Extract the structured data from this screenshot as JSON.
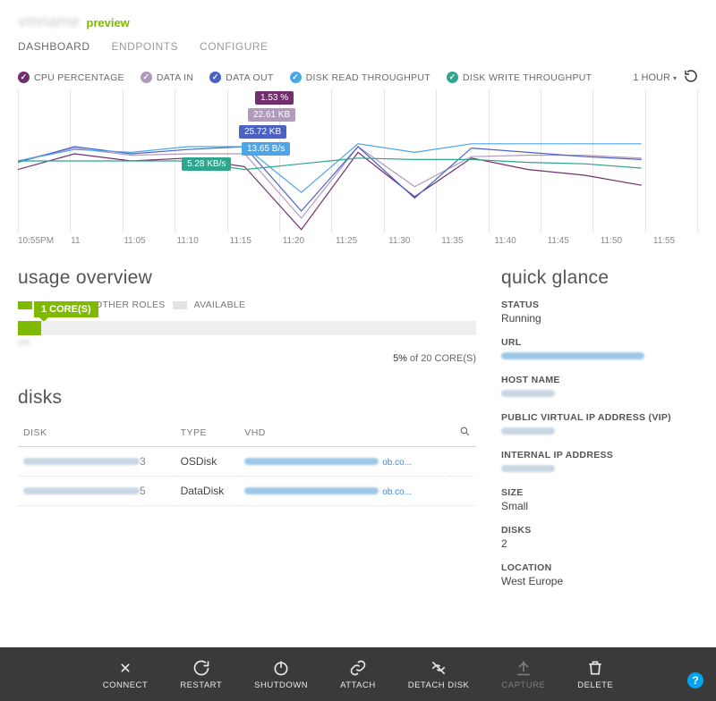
{
  "header": {
    "vm_name": "vmname",
    "preview_label": "preview"
  },
  "tabs": {
    "dashboard": "DASHBOARD",
    "endpoints": "ENDPOINTS",
    "configure": "CONFIGURE",
    "active": "dashboard"
  },
  "chart_legend": {
    "cpu": {
      "label": "CPU PERCENTAGE",
      "color": "#722f6e"
    },
    "data_in": {
      "label": "DATA IN",
      "color": "#b29abf"
    },
    "data_out": {
      "label": "DATA OUT",
      "color": "#4b61c3"
    },
    "disk_read": {
      "label": "DISK READ THROUGHPUT",
      "color": "#4ba6e8"
    },
    "disk_write": {
      "label": "DISK WRITE THROUGHPUT",
      "color": "#2fa58e"
    }
  },
  "timerange": {
    "label": "1 HOUR"
  },
  "chart_tooltips": {
    "cpu": "1.53 %",
    "data_in": "22.61 KB",
    "data_out": "25.72 KB",
    "disk_read": "13.65 B/s",
    "disk_write": "5.28 KB/s"
  },
  "chart_data": {
    "type": "line",
    "title": "",
    "x": [
      "10:55PM",
      "11",
      "11:05",
      "11:10",
      "11:15",
      "11:20",
      "11:25",
      "11:30",
      "11:35",
      "11:40",
      "11:45",
      "11:50",
      "11:55"
    ],
    "series": [
      {
        "name": "CPU PERCENTAGE",
        "color": "#722f6e",
        "values_rel": [
          0.44,
          0.55,
          0.5,
          0.52,
          0.46,
          0.02,
          0.56,
          0.25,
          0.52,
          0.44,
          0.4,
          0.33,
          null
        ],
        "peak_label": "1.53 %"
      },
      {
        "name": "DATA IN",
        "color": "#b29abf",
        "values_rel": [
          0.5,
          0.59,
          0.54,
          0.55,
          0.55,
          0.1,
          0.6,
          0.32,
          0.53,
          0.54,
          0.54,
          0.52,
          null
        ],
        "peak_label": "22.61 KB"
      },
      {
        "name": "DATA OUT",
        "color": "#4b61c3",
        "values_rel": [
          0.49,
          0.6,
          0.55,
          0.58,
          0.6,
          0.15,
          0.6,
          0.24,
          0.59,
          0.56,
          0.53,
          0.51,
          null
        ],
        "peak_label": "25.72 KB"
      },
      {
        "name": "DISK READ THROUGHPUT",
        "color": "#4ba6e8",
        "values_rel": [
          0.5,
          0.58,
          0.56,
          0.6,
          0.6,
          0.28,
          0.62,
          0.56,
          0.62,
          0.62,
          0.62,
          0.62,
          null
        ],
        "peak_label": "13.65 B/s"
      },
      {
        "name": "DISK WRITE THROUGHPUT",
        "color": "#2fa58e",
        "values_rel": [
          0.5,
          0.5,
          0.5,
          0.5,
          0.44,
          0.48,
          0.52,
          0.51,
          0.51,
          0.49,
          0.48,
          0.45,
          null
        ],
        "peak_label": "5.28 KB/s"
      }
    ],
    "note": "values_rel are fractional heights (0=bottom,1=top) within the chart viewport; the source image does not expose a y-axis scale."
  },
  "usage": {
    "title": "usage overview",
    "other_roles_label": "OTHER ROLES",
    "available_label": "AVAILABLE",
    "core_label": "1 CORE(S)",
    "percent_text": "5%",
    "of_text": " of 20 CORE(S)"
  },
  "disks": {
    "title": "disks",
    "columns": {
      "disk": "DISK",
      "type": "TYPE",
      "vhd": "VHD"
    },
    "rows": [
      {
        "name_suffix": "3",
        "type": "OSDisk",
        "vhd_suffix": "ob.co..."
      },
      {
        "name_suffix": "5",
        "type": "DataDisk",
        "vhd_suffix": "ob.co..."
      }
    ]
  },
  "quick_glance": {
    "title": "quick glance",
    "items": {
      "status": {
        "label": "STATUS",
        "value": "Running"
      },
      "url": {
        "label": "URL",
        "redacted": true
      },
      "host": {
        "label": "HOST NAME",
        "redacted": true
      },
      "vip": {
        "label": "PUBLIC VIRTUAL IP ADDRESS (VIP)",
        "redacted": true
      },
      "internal": {
        "label": "INTERNAL IP ADDRESS",
        "redacted": true
      },
      "size": {
        "label": "SIZE",
        "value": "Small"
      },
      "disks": {
        "label": "DISKS",
        "value": "2"
      },
      "location": {
        "label": "LOCATION",
        "value": "West Europe"
      }
    }
  },
  "commands": {
    "connect": "CONNECT",
    "restart": "RESTART",
    "shutdown": "SHUTDOWN",
    "attach": "ATTACH",
    "detach_disk": "DETACH DISK",
    "capture": "CAPTURE",
    "delete": "DELETE"
  }
}
